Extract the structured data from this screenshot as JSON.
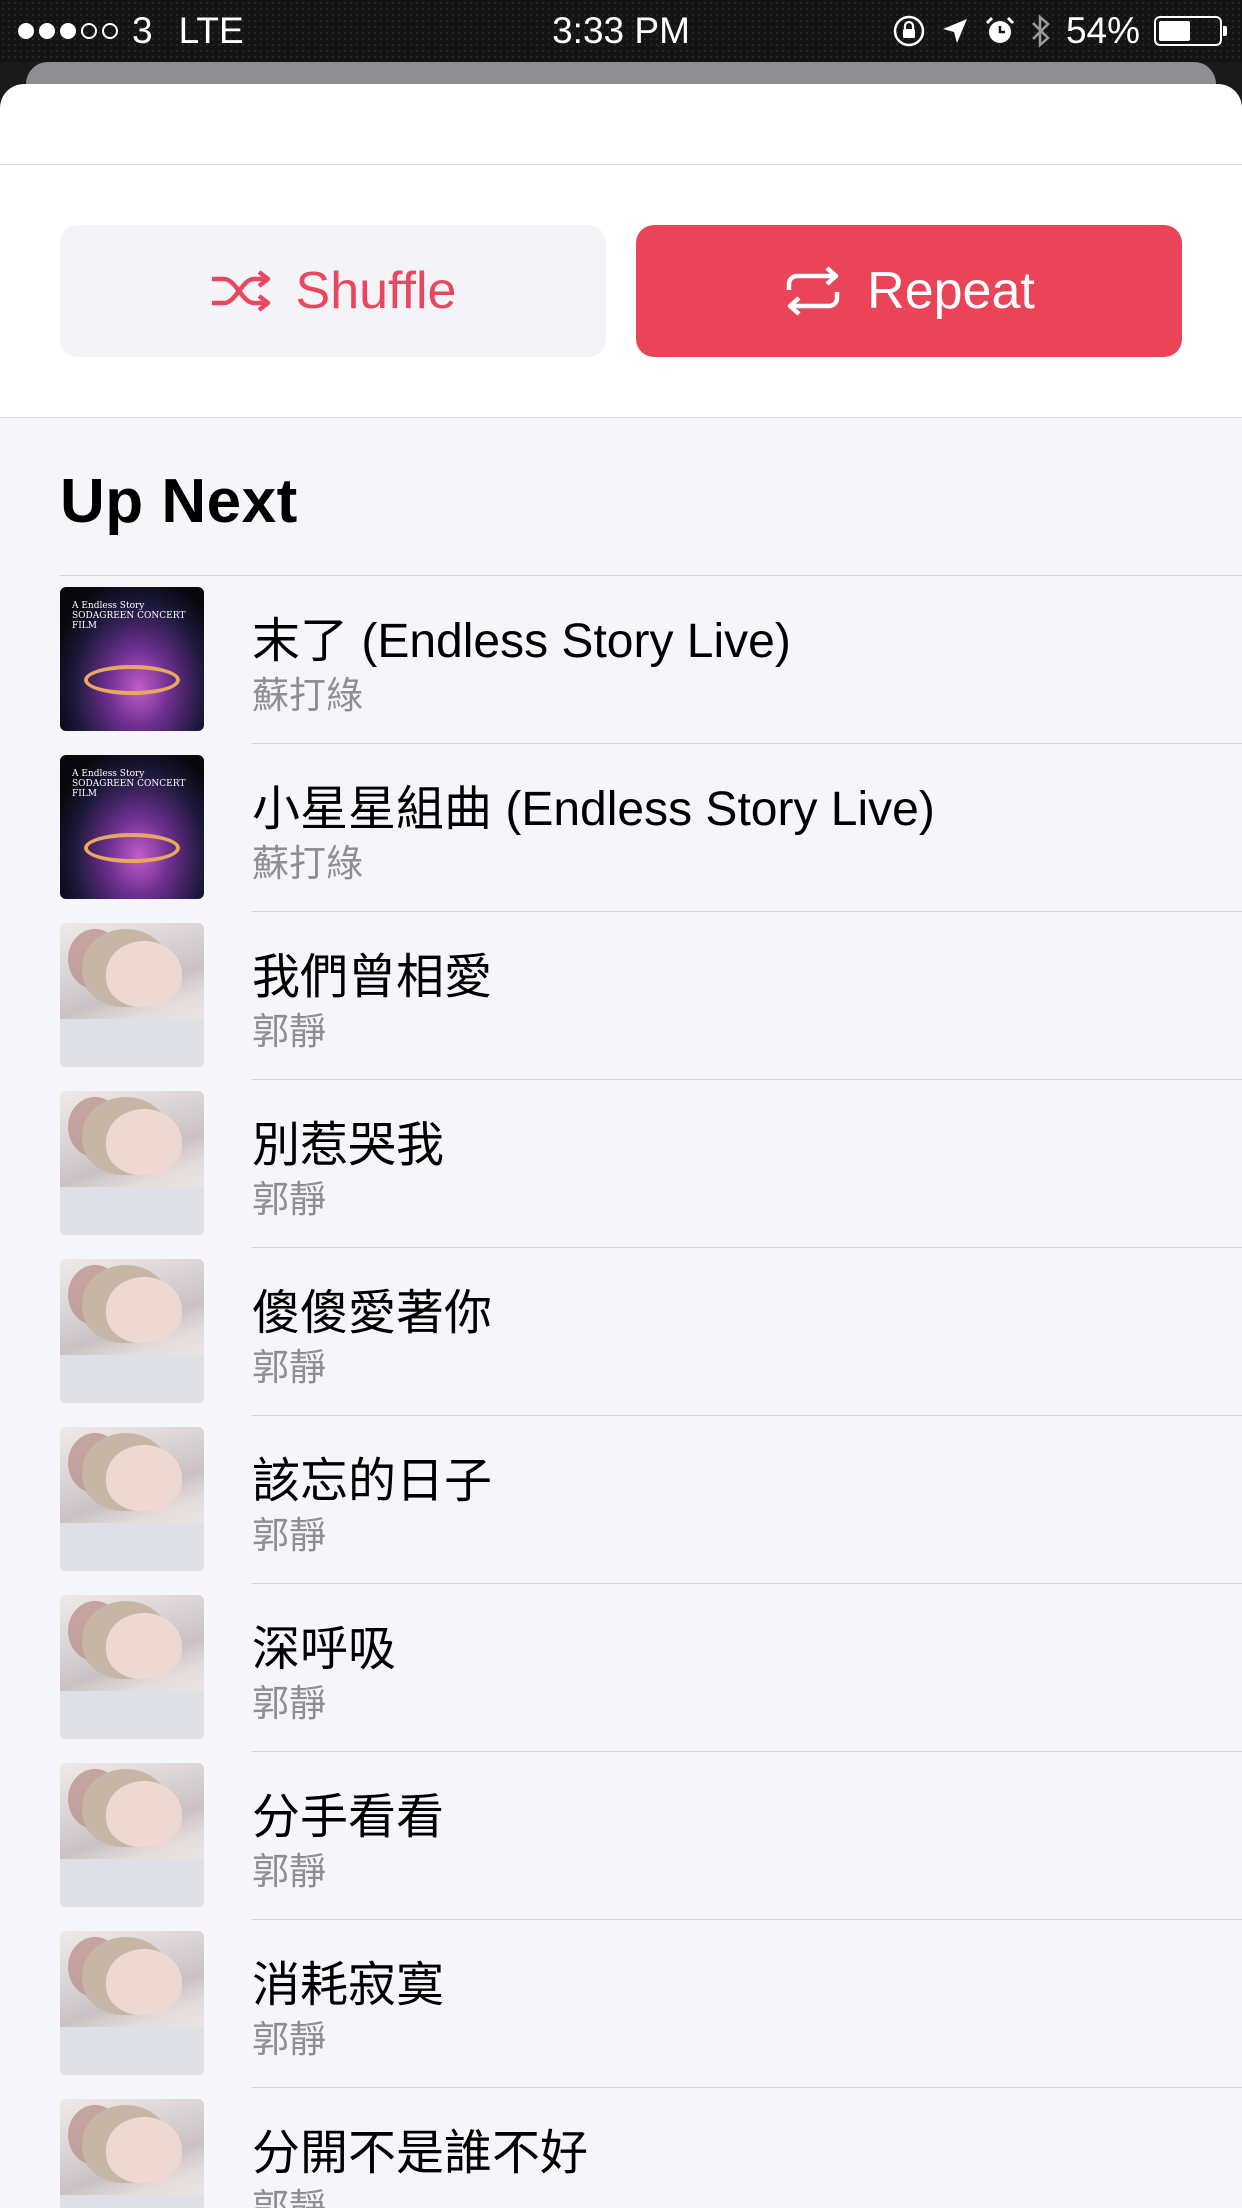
{
  "status_bar": {
    "signal_dots_filled": 3,
    "signal_dots_total": 5,
    "carrier": "3",
    "network": "LTE",
    "time": "3:33 PM",
    "battery_percent": "54%",
    "battery_level": 0.54,
    "icons": [
      "orientation-lock-icon",
      "location-arrow-icon",
      "alarm-icon",
      "bluetooth-icon",
      "battery-icon"
    ]
  },
  "controls": {
    "shuffle_label": "Shuffle",
    "repeat_label": "Repeat",
    "shuffle_active": false,
    "repeat_active": true,
    "accent_color": "#ea4459"
  },
  "up_next": {
    "heading": "Up Next",
    "tracks": [
      {
        "title": "末了 (Endless Story Live)",
        "artist": "蘇打綠",
        "artwork": "concert"
      },
      {
        "title": "小星星組曲 (Endless Story Live)",
        "artist": "蘇打綠",
        "artwork": "concert"
      },
      {
        "title": "我們曾相愛",
        "artist": "郭靜",
        "artwork": "portrait"
      },
      {
        "title": "別惹哭我",
        "artist": "郭靜",
        "artwork": "portrait"
      },
      {
        "title": "傻傻愛著你",
        "artist": "郭靜",
        "artwork": "portrait"
      },
      {
        "title": "該忘的日子",
        "artist": "郭靜",
        "artwork": "portrait"
      },
      {
        "title": "深呼吸",
        "artist": "郭靜",
        "artwork": "portrait"
      },
      {
        "title": "分手看看",
        "artist": "郭靜",
        "artwork": "portrait"
      },
      {
        "title": "消耗寂寞",
        "artist": "郭靜",
        "artwork": "portrait"
      },
      {
        "title": "分開不是誰不好",
        "artist": "郭靜",
        "artwork": "portrait"
      }
    ],
    "concert_art_text": "A Endless Story SODAGREEN CONCERT FILM"
  }
}
